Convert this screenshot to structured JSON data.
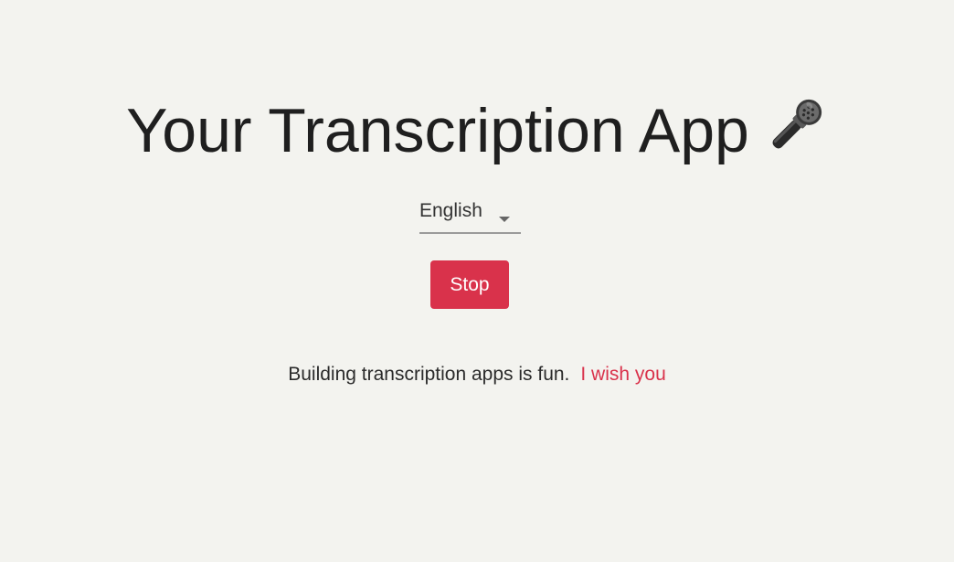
{
  "header": {
    "title": "Your Transcription App",
    "title_icon": "microphone-icon"
  },
  "language_select": {
    "selected": "English",
    "icon": "caret-down-icon"
  },
  "controls": {
    "stop_label": "Stop"
  },
  "transcript": {
    "final_text": "Building transcription apps is fun.",
    "interim_text": "I wish you"
  },
  "colors": {
    "background": "#f3f3ef",
    "accent": "#d9324b",
    "text": "#222222"
  }
}
